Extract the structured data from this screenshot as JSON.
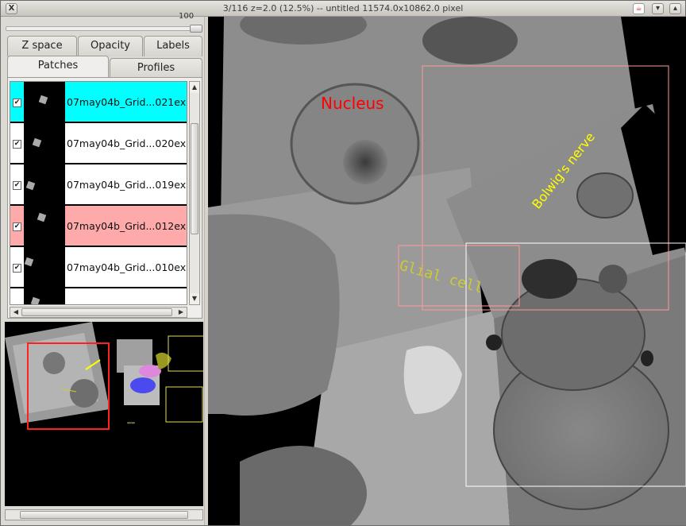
{
  "window": {
    "title": "3/116 z=2.0 (12.5%) -- untitled  11574.0x10862.0 pixel",
    "close_label": "X",
    "min_label": "▾",
    "max_label": "▴",
    "java_label": "☕"
  },
  "slider": {
    "value": "100"
  },
  "tabs": {
    "z_space": "Z space",
    "opacity": "Opacity",
    "labels": "Labels",
    "patches": "Patches",
    "profiles": "Profiles"
  },
  "patches": [
    {
      "name": "07may04b_Grid...021ex",
      "checked": true,
      "bg": "#00ffff"
    },
    {
      "name": "07may04b_Grid...020ex",
      "checked": true,
      "bg": "#ffffff"
    },
    {
      "name": "07may04b_Grid...019ex",
      "checked": true,
      "bg": "#ffffff"
    },
    {
      "name": "07may04b_Grid...012ex",
      "checked": true,
      "bg": "#ffaaaa"
    },
    {
      "name": "07may04b_Grid...010ex",
      "checked": true,
      "bg": "#ffffff"
    }
  ],
  "canvas_labels": {
    "nucleus": "Nucleus",
    "bolwig": "Bolwig's nerve",
    "glial": "Glial cell"
  },
  "colors": {
    "nucleus": "#ff0000",
    "bolwig": "#ffff00",
    "glial": "#cccc33",
    "selection_pink": "#ff9999",
    "selection_white": "#ffffff",
    "navigator_frame": "#ff0000"
  }
}
